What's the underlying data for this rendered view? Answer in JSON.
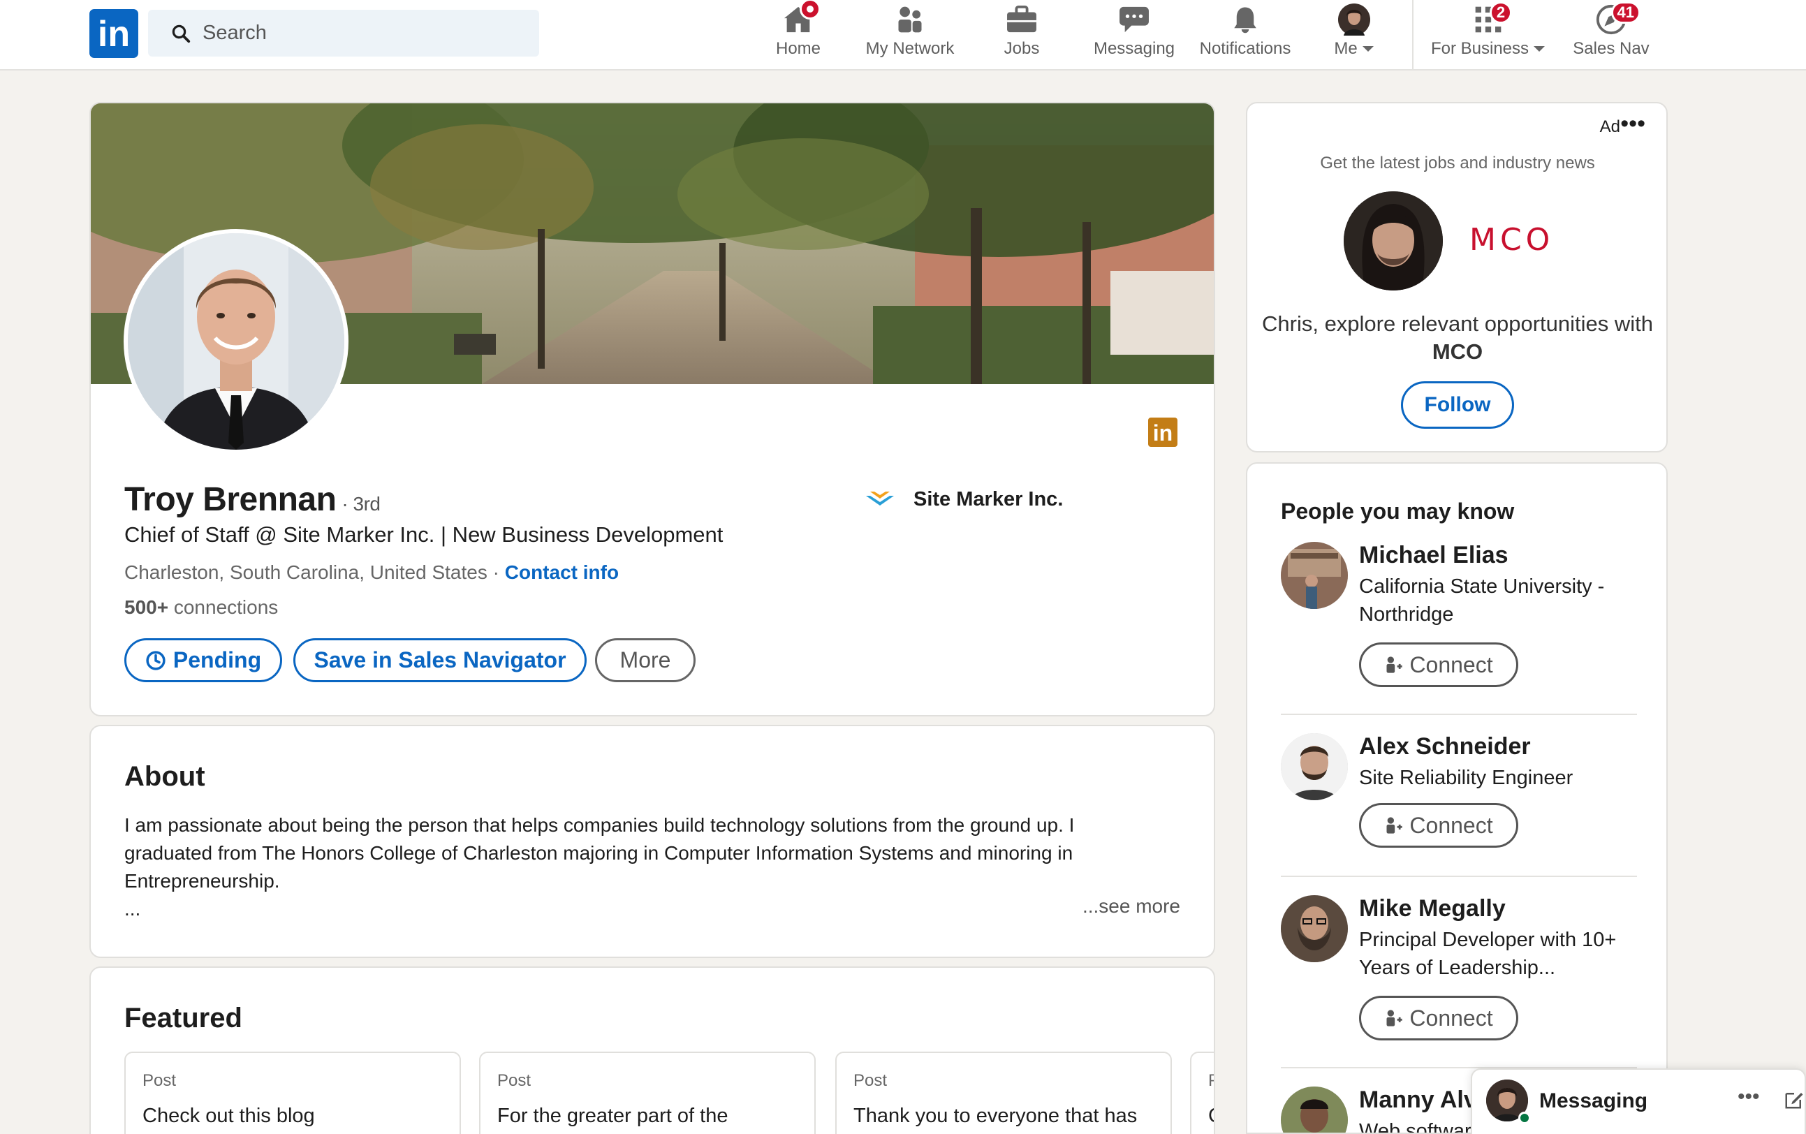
{
  "nav": {
    "logo_text": "in",
    "search_placeholder": "Search",
    "items": [
      {
        "label": "Home",
        "icon": "home-icon",
        "badge": "•"
      },
      {
        "label": "My Network",
        "icon": "people-icon",
        "badge": ""
      },
      {
        "label": "Jobs",
        "icon": "briefcase-icon",
        "badge": ""
      },
      {
        "label": "Messaging",
        "icon": "chat-icon",
        "badge": ""
      },
      {
        "label": "Notifications",
        "icon": "bell-icon",
        "badge": ""
      },
      {
        "label": "Me",
        "icon": "avatar",
        "badge": ""
      },
      {
        "label": "For Business",
        "icon": "grid-icon",
        "badge": "2"
      },
      {
        "label": "Sales Nav",
        "icon": "compass-icon",
        "badge": "41"
      }
    ]
  },
  "profile": {
    "name": "Troy Brennan",
    "degree": "· 3rd",
    "headline": "Chief of Staff @ Site Marker Inc. | New Business Development",
    "location": "Charleston, South Carolina, United States",
    "location_sep": " · ",
    "contact_info": "Contact info",
    "connections_count": "500+",
    "connections_label": " connections",
    "company": "Site Marker Inc.",
    "linkedin_badge": "in",
    "buttons": {
      "pending": "Pending",
      "save": "Save in Sales Navigator",
      "more": "More"
    }
  },
  "about": {
    "title": "About",
    "text": "I am passionate about being the person that helps companies build technology solutions from the ground up. I graduated from The Honors College of Charleston majoring in Computer Information Systems and minoring in Entrepreneurship.",
    "ellipsis": "...",
    "see_more": "...see more"
  },
  "featured": {
    "title": "Featured",
    "posts": [
      {
        "type": "Post",
        "text": "Check out this blog"
      },
      {
        "type": "Post",
        "text": "For the greater part of the"
      },
      {
        "type": "Post",
        "text": "Thank you to everyone that has"
      },
      {
        "type": "P",
        "text": "C"
      }
    ]
  },
  "ad": {
    "label": "Ad",
    "dots": "•••",
    "subtitle": "Get the latest jobs and industry news",
    "brand": "MCO",
    "message_prefix": "Chris, explore relevant opportunities with ",
    "message_brand": "MCO",
    "follow": "Follow"
  },
  "pymk": {
    "title": "People you may know",
    "connect_label": "Connect",
    "people": [
      {
        "name": "Michael Elias",
        "title": "California State University - Northridge"
      },
      {
        "name": "Alex Schneider",
        "title": "Site Reliability Engineer"
      },
      {
        "name": "Mike Megally",
        "title": "Principal Developer with 10+ Years of Leadership..."
      },
      {
        "name": "Manny Alva",
        "title": "Web software"
      }
    ]
  },
  "messaging": {
    "label": "Messaging",
    "dots": "•••"
  },
  "colors": {
    "brand_blue": "#0a66c2",
    "badge_red": "#cb112d",
    "page_bg": "#f4f2ee",
    "ad_brand_red": "#c8102e"
  }
}
